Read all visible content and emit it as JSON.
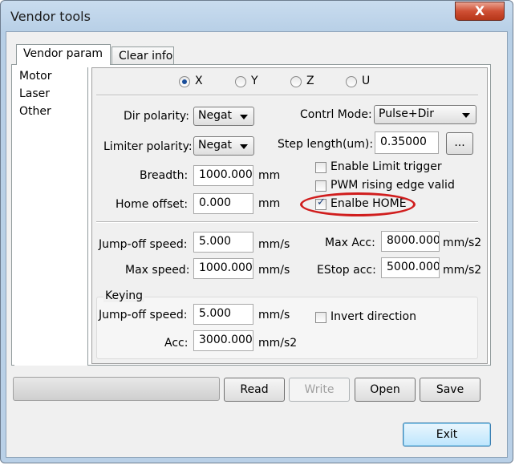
{
  "window": {
    "title": "Vendor tools",
    "close_glyph": "X"
  },
  "tabs": [
    {
      "label": "Vendor param"
    },
    {
      "label": "Clear info"
    }
  ],
  "sidebar": {
    "items": [
      {
        "label": "Motor"
      },
      {
        "label": "Laser"
      },
      {
        "label": "Other"
      }
    ]
  },
  "axes": {
    "x": "X",
    "y": "Y",
    "z": "Z",
    "u": "U",
    "selected": "X"
  },
  "params": {
    "dir_polarity_label": "Dir polarity:",
    "dir_polarity_value": "Negat",
    "limiter_polarity_label": "Limiter polarity:",
    "limiter_polarity_value": "Negat",
    "breadth_label": "Breadth:",
    "breadth_value": "1000.000",
    "breadth_unit": "mm",
    "home_offset_label": "Home offset:",
    "home_offset_value": "0.000",
    "home_offset_unit": "mm",
    "control_mode_label": "Contrl Mode:",
    "control_mode_value": "Pulse+Dir",
    "step_length_label": "Step length(um):",
    "step_length_value": "0.35000",
    "step_length_button": "...",
    "enable_limit_trigger": "Enable Limit trigger",
    "pwm_rising_edge": "PWM rising edge valid",
    "enable_home": "Enalbe HOME"
  },
  "speed": {
    "jump_off_label": "Jump-off speed:",
    "jump_off_value": "5.000",
    "jump_off_unit": "mm/s",
    "max_speed_label": "Max speed:",
    "max_speed_value": "1000.000",
    "max_speed_unit": "mm/s",
    "max_acc_label": "Max Acc:",
    "max_acc_value": "8000.000",
    "max_acc_unit": "mm/s2",
    "estop_acc_label": "EStop acc:",
    "estop_acc_value": "5000.000",
    "estop_acc_unit": "mm/s2"
  },
  "keying": {
    "group_label": "Keying",
    "jump_off_label": "Jump-off speed:",
    "jump_off_value": "5.000",
    "jump_off_unit": "mm/s",
    "acc_label": "Acc:",
    "acc_value": "3000.000",
    "acc_unit": "mm/s2",
    "invert_direction": "Invert direction"
  },
  "buttons": {
    "read": "Read",
    "write": "Write",
    "open": "Open",
    "save": "Save",
    "exit": "Exit"
  },
  "checkbox_state": {
    "enable_limit_trigger": false,
    "pwm_rising_edge": false,
    "enable_home": true,
    "invert_direction": false
  },
  "colors": {
    "highlight_ellipse": "#d01d1d",
    "title_bar": "#b9d0e7"
  }
}
